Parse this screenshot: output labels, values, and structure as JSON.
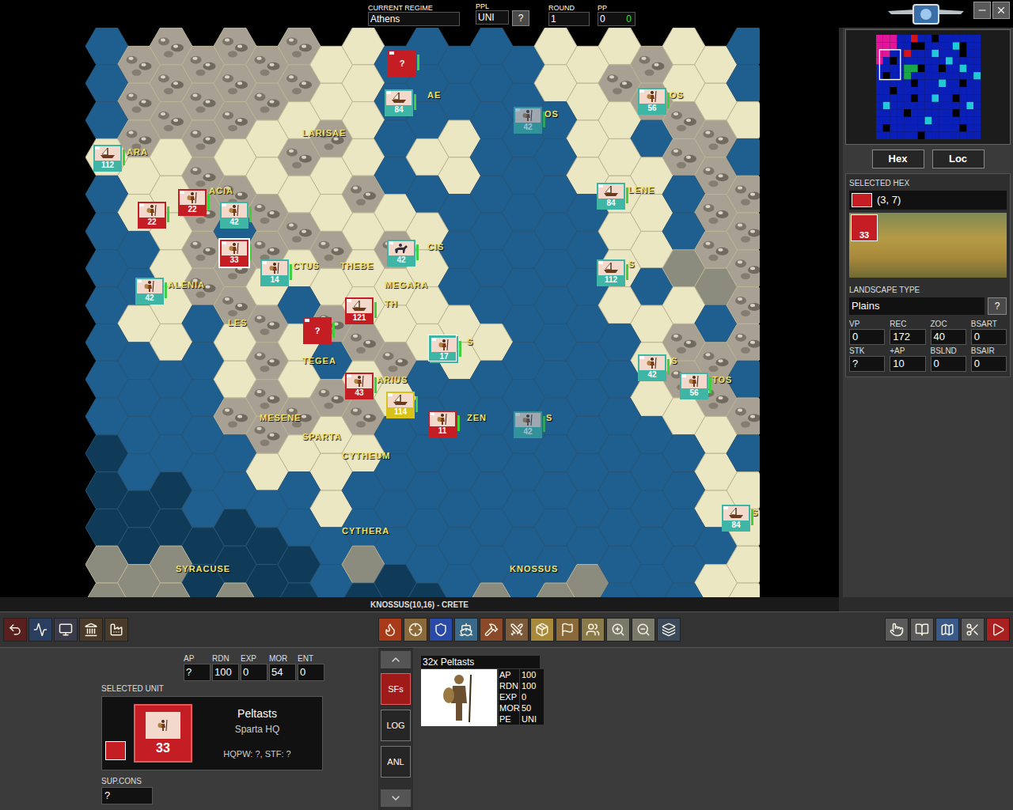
{
  "top_bar": {
    "regime_label": "CURRENT REGIME",
    "regime": "Athens",
    "ppl_label": "PPL",
    "ppl": "UNI",
    "help": "?",
    "round_label": "ROUND",
    "round": "1",
    "pp_label": "PP",
    "pp": "0",
    "pp_gain": "0"
  },
  "map": {
    "cities": [
      {
        "name": "AE"
      },
      {
        "name": "OS"
      },
      {
        "name": "OS"
      },
      {
        "name": "LARISAE"
      },
      {
        "name": "ARA"
      },
      {
        "name": "ACIA"
      },
      {
        "name": "LENE"
      },
      {
        "name": "CIS"
      },
      {
        "name": "CTUS"
      },
      {
        "name": "THEBE"
      },
      {
        "name": "MEGARA"
      },
      {
        "name": "ALENIA"
      },
      {
        "name": "TH"
      },
      {
        "name": "S"
      },
      {
        "name": "LES"
      },
      {
        "name": "S"
      },
      {
        "name": "TEGEA"
      },
      {
        "name": "ARIUS"
      },
      {
        "name": "S"
      },
      {
        "name": "TOS"
      },
      {
        "name": "MESENE"
      },
      {
        "name": "ZEN"
      },
      {
        "name": "S"
      },
      {
        "name": "SPARTA"
      },
      {
        "name": "CYTHEUM"
      },
      {
        "name": "CYTHERA"
      },
      {
        "name": "SYRACUSE"
      },
      {
        "name": "KNOSSUS"
      },
      {
        "name": "S"
      }
    ],
    "units": [
      {
        "label": "?",
        "kind": "unknown",
        "color": "#c41e24",
        "selected": false,
        "faded": false
      },
      {
        "label": "84",
        "kind": "ship",
        "color": "#3fb5a5",
        "selected": false,
        "faded": false
      },
      {
        "label": "42",
        "kind": "infantry",
        "color": "#3fb5a5",
        "selected": false,
        "faded": true
      },
      {
        "label": "56",
        "kind": "infantry",
        "color": "#3fb5a5",
        "selected": false,
        "faded": false
      },
      {
        "label": "112",
        "kind": "ship",
        "color": "#3fb5a5",
        "selected": false,
        "faded": false
      },
      {
        "label": "22",
        "kind": "infantry",
        "color": "#c41e24",
        "selected": false,
        "faded": false
      },
      {
        "label": "22",
        "kind": "infantry",
        "color": "#c41e24",
        "selected": false,
        "faded": false
      },
      {
        "label": "42",
        "kind": "infantry",
        "color": "#3fb5a5",
        "selected": false,
        "faded": false
      },
      {
        "label": "33",
        "kind": "infantry",
        "color": "#c41e24",
        "selected": true,
        "faded": false
      },
      {
        "label": "14",
        "kind": "infantry",
        "color": "#3fb5a5",
        "selected": false,
        "faded": false
      },
      {
        "label": "42",
        "kind": "cavalry",
        "color": "#3fb5a5",
        "selected": false,
        "faded": false
      },
      {
        "label": "84",
        "kind": "ship",
        "color": "#3fb5a5",
        "selected": false,
        "faded": false
      },
      {
        "label": "112",
        "kind": "ship",
        "color": "#3fb5a5",
        "selected": false,
        "faded": false
      },
      {
        "label": "42",
        "kind": "infantry",
        "color": "#3fb5a5",
        "selected": false,
        "faded": false
      },
      {
        "label": "121",
        "kind": "ship",
        "color": "#c41e24",
        "selected": false,
        "faded": false
      },
      {
        "label": "?",
        "kind": "unknown",
        "color": "#c41e24",
        "selected": false,
        "faded": false
      },
      {
        "label": "17",
        "kind": "stack",
        "color": "#3fb5a5",
        "selected": false,
        "faded": false
      },
      {
        "label": "43",
        "kind": "infantry",
        "color": "#c41e24",
        "selected": false,
        "faded": false
      },
      {
        "label": "114",
        "kind": "ship",
        "color": "#d8c21a",
        "selected": false,
        "faded": false
      },
      {
        "label": "11",
        "kind": "infantry",
        "color": "#c41e24",
        "selected": false,
        "faded": false
      },
      {
        "label": "42",
        "kind": "infantry",
        "color": "#3fb5a5",
        "selected": false,
        "faded": true
      },
      {
        "label": "42",
        "kind": "infantry",
        "color": "#3fb5a5",
        "selected": false,
        "faded": false
      },
      {
        "label": "56",
        "kind": "infantry",
        "color": "#3fb5a5",
        "selected": false,
        "faded": false
      },
      {
        "label": "84",
        "kind": "ship",
        "color": "#3fb5a5",
        "selected": false,
        "faded": false
      }
    ]
  },
  "hex_panel": {
    "tabs": [
      {
        "label": "Hex",
        "selected": false
      },
      {
        "label": "Loc",
        "selected": false
      }
    ],
    "title": "SELECTED HEX",
    "coords": "(3, 7)",
    "unit_badge": "33",
    "landscape_label": "LANDSCAPE TYPE",
    "landscape": "Plains",
    "help": "?",
    "stats": [
      {
        "label": "VP",
        "value": "0"
      },
      {
        "label": "REC",
        "value": "172"
      },
      {
        "label": "ZOC",
        "value": "40"
      },
      {
        "label": "BSART",
        "value": "0"
      },
      {
        "label": "STK",
        "value": "?"
      },
      {
        "label": "+AP",
        "value": "10"
      },
      {
        "label": "BSLND",
        "value": "0"
      },
      {
        "label": "BSAIR",
        "value": "0"
      }
    ]
  },
  "status_line": "KNOSSUS(10,16) - CRETE",
  "unit_panel": {
    "stats": [
      {
        "label": "AP",
        "value": "?"
      },
      {
        "label": "RDN",
        "value": "100"
      },
      {
        "label": "EXP",
        "value": "0"
      },
      {
        "label": "MOR",
        "value": "54"
      },
      {
        "label": "ENT",
        "value": "0"
      }
    ],
    "title": "SELECTED UNIT",
    "badge": "33",
    "name": "Peltasts",
    "hq": "Sparta HQ",
    "hq_info": "HQPW: ?, STF: ?",
    "sup_label": "SUP.CONS",
    "sup": "?"
  },
  "side_tabs": [
    {
      "label": "SFs",
      "selected": true
    },
    {
      "label": "LOG",
      "selected": false
    },
    {
      "label": "ANL",
      "selected": false
    }
  ],
  "subformation": {
    "title": "32x Peltasts",
    "stats": [
      {
        "label": "AP",
        "value": "100"
      },
      {
        "label": "RDN",
        "value": "100"
      },
      {
        "label": "EXP",
        "value": "0"
      },
      {
        "label": "MOR",
        "value": "50"
      },
      {
        "label": "PE",
        "value": "UNI"
      }
    ]
  }
}
